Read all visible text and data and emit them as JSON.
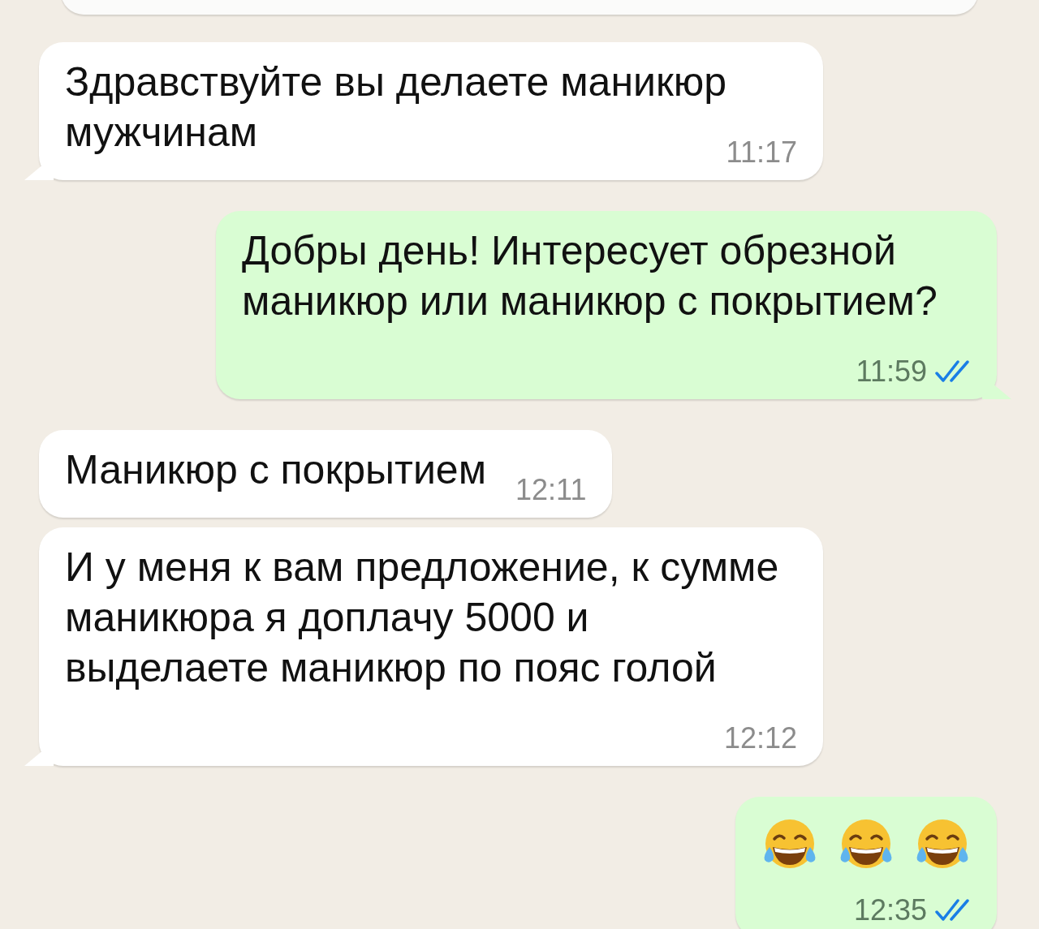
{
  "messages": [
    {
      "kind": "incoming",
      "text": "Здравствуйте вы делаете маникюр мужчинам",
      "time": "11:17",
      "tail": true
    },
    {
      "kind": "outgoing",
      "text": "Добры день! Интересует обрезной маникюр или маникюр с покрытием?",
      "time": "11:59",
      "tail": true,
      "read": true
    },
    {
      "kind": "incoming",
      "text": "Маникюр с покрытием",
      "time": "12:11",
      "tail": false
    },
    {
      "kind": "incoming",
      "text": "И у меня к вам предложение, к сумме маникюра я доплачу 5000 и выделаете маникюр по пояс голой",
      "time": "12:12",
      "tail": true
    },
    {
      "kind": "outgoing",
      "emojis": [
        {
          "kind": "tears-of-joy"
        },
        {
          "kind": "tears-of-joy"
        },
        {
          "kind": "tears-of-joy"
        }
      ],
      "time": "12:35",
      "tail": false,
      "read": true
    }
  ]
}
